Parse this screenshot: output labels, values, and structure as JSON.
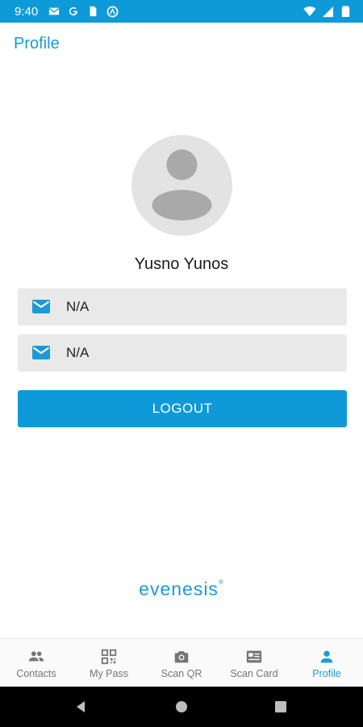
{
  "status_bar": {
    "time": "9:40",
    "icons_left": [
      "mail-icon",
      "google-icon",
      "sim-icon",
      "vpn-icon"
    ],
    "icons_right": [
      "wifi-icon",
      "signal-icon",
      "battery-icon"
    ]
  },
  "header": {
    "title": "Profile"
  },
  "profile": {
    "name": "Yusno Yunos",
    "fields": [
      {
        "icon": "mail-icon",
        "value": "N/A"
      },
      {
        "icon": "mail-icon",
        "value": "N/A"
      }
    ],
    "logout_label": "LOGOUT"
  },
  "brand": {
    "text": "evenesis",
    "mark": "®"
  },
  "bottom_nav": {
    "items": [
      {
        "label": "Contacts",
        "icon": "contacts-icon",
        "active": false
      },
      {
        "label": "My Pass",
        "icon": "qr-code-icon",
        "active": false
      },
      {
        "label": "Scan QR",
        "icon": "camera-icon",
        "active": false
      },
      {
        "label": "Scan Card",
        "icon": "card-icon",
        "active": false
      },
      {
        "label": "Profile",
        "icon": "person-icon",
        "active": true
      }
    ]
  },
  "colors": {
    "accent": "#0e9ad9",
    "field_bg": "#e9e9e9",
    "nav_inactive": "#757575"
  }
}
